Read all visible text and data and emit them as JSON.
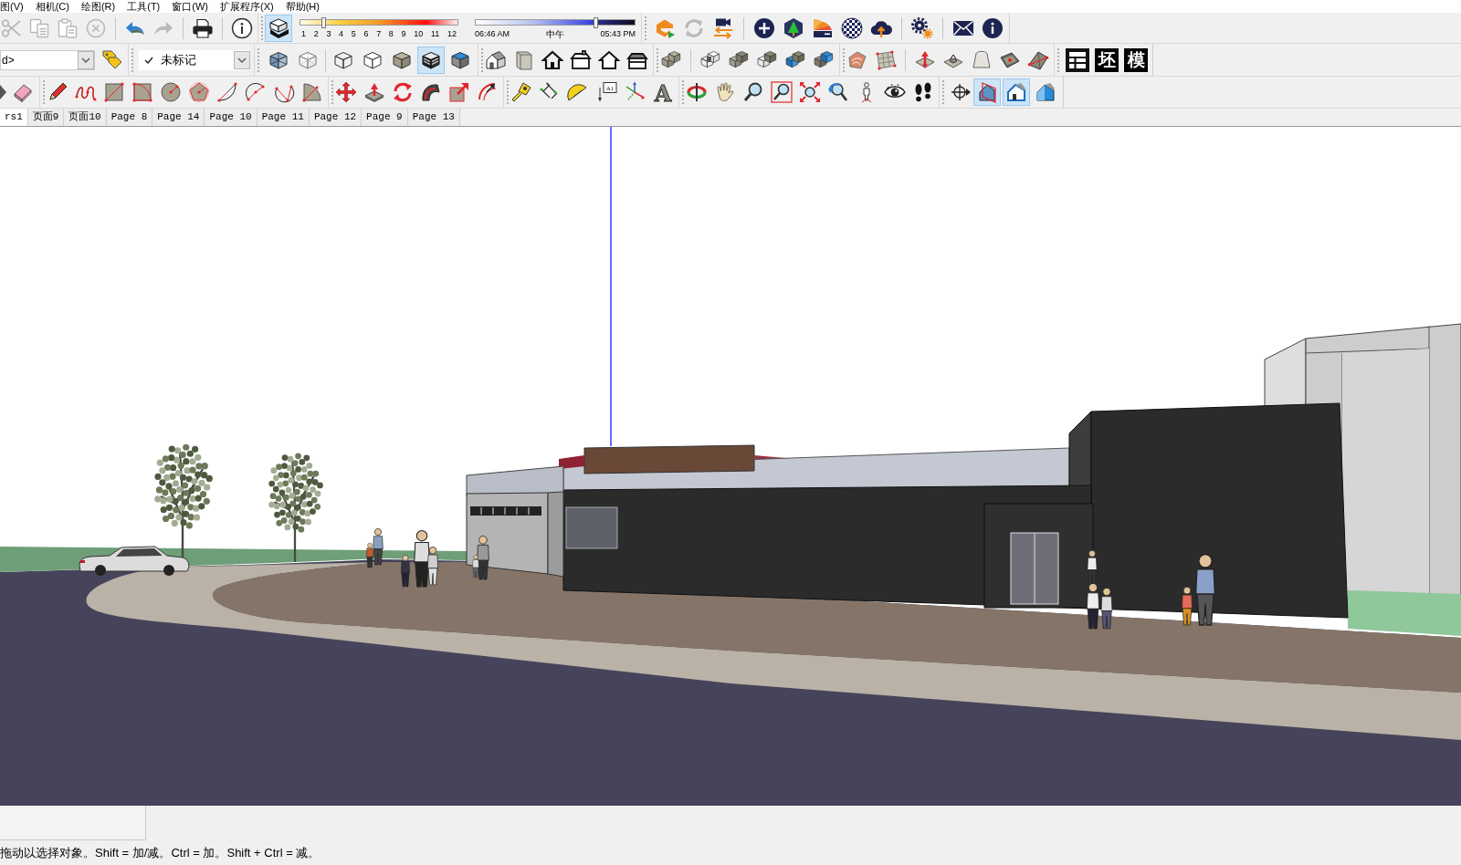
{
  "menu_bar": {
    "items": [
      "图(V)",
      "相机(C)",
      "绘图(R)",
      "工具(T)",
      "窗口(W)",
      "扩展程序(X)",
      "帮助(H)"
    ]
  },
  "edit_toolbar": {
    "buttons": [
      {
        "disabled": true
      },
      {
        "disabled": true
      },
      {
        "disabled": true
      },
      {
        "disabled": true
      },
      {
        "disabled": false
      },
      {
        "disabled": true
      },
      {
        "disabled": false
      },
      {
        "disabled": false
      }
    ]
  },
  "shadows_toolbar": {
    "shadows_on": true,
    "month_slider": {
      "labels": [
        "1",
        "2",
        "3",
        "4",
        "5",
        "6",
        "7",
        "8",
        "9",
        "10",
        "11",
        "12"
      ],
      "level": 0.15
    },
    "time_slider": {
      "start": "06:46 AM",
      "middle": "中午",
      "end": "05:43 PM",
      "level": 0.75
    }
  },
  "layer_dropdown": {
    "value": "d>"
  },
  "tag_dropdown": {
    "value": "未标记"
  },
  "styles_toolbar": {
    "xray": false,
    "back_edges": false,
    "modes": [
      {
        "selected": false
      },
      {
        "selected": false
      },
      {
        "selected": false
      },
      {
        "selected": true
      },
      {
        "selected": false
      }
    ]
  },
  "custom_toolbar": {
    "labels": [
      "坯",
      "模"
    ]
  },
  "text_tools": {
    "text_label": "A1",
    "three_d_text": "A"
  },
  "section_toolbar": {
    "planes_shown": true,
    "cuts_shown": true,
    "fill_shown": false
  },
  "scene_tabs": [
    {
      "label": "rs1",
      "selected": true
    },
    {
      "label": "页面9",
      "selected": false
    },
    {
      "label": "页面10",
      "selected": false
    },
    {
      "label": "Page 8",
      "selected": false
    },
    {
      "label": "Page 14",
      "selected": false
    },
    {
      "label": "Page 10",
      "selected": false
    },
    {
      "label": "Page 11",
      "selected": false
    },
    {
      "label": "Page 12",
      "selected": false
    },
    {
      "label": "Page 9",
      "selected": false
    },
    {
      "label": "Page 13",
      "selected": false
    }
  ],
  "status_bar": {
    "text": "拖动以选择对象。Shift = 加/减。Ctrl = 加。Shift + Ctrl = 减。"
  }
}
